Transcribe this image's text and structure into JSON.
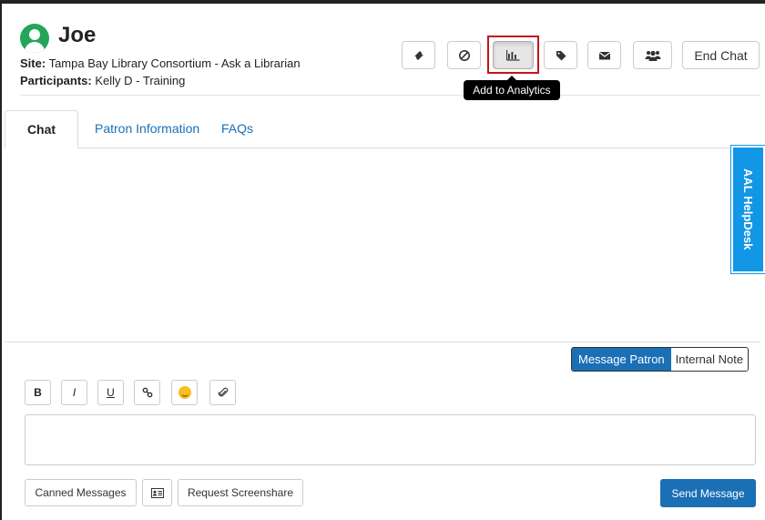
{
  "header": {
    "patron_name": "Joe",
    "site_label": "Site:",
    "site_value": "Tampa Bay Library Consortium - Ask a Librarian",
    "participants_label": "Participants:",
    "participants_value": "Kelly D - Training"
  },
  "toolbar": {
    "buttons": [
      {
        "icon": "ticket-icon"
      },
      {
        "icon": "ban-icon"
      },
      {
        "icon": "bar-chart-icon",
        "active": true
      },
      {
        "icon": "tag-icon"
      },
      {
        "icon": "envelope-icon"
      },
      {
        "icon": "users-icon"
      }
    ],
    "end_chat_label": "End Chat",
    "tooltip": "Add to Analytics"
  },
  "tabs": [
    {
      "label": "Chat",
      "active": true
    },
    {
      "label": "Patron Information"
    },
    {
      "label": "FAQs"
    }
  ],
  "helpdesk_label": "AAL HelpDesk",
  "message_mode": {
    "options": [
      "Message Patron",
      "Internal Note"
    ],
    "selected": "Message Patron"
  },
  "formatting": {
    "bold": "B",
    "italic": "I",
    "underline": "U"
  },
  "compose": {
    "value": ""
  },
  "bottom": {
    "canned_messages": "Canned Messages",
    "request_screenshare": "Request Screenshare",
    "send_message": "Send Message"
  },
  "colors": {
    "accent": "#1a6fb5",
    "helpdesk": "#1296e6",
    "avatar": "#25a55a",
    "highlight": "#c0161d"
  }
}
